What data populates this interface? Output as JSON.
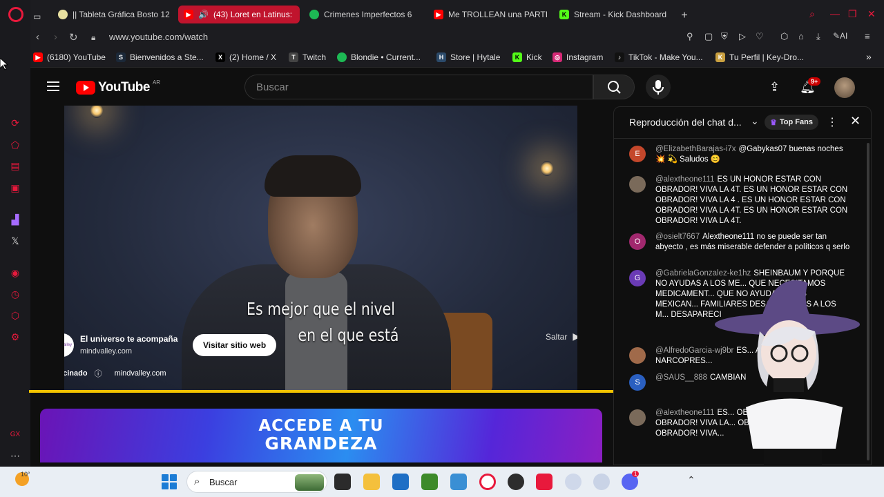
{
  "browser": {
    "tabs": [
      {
        "label": "|| Tableta Gráfica Bosto 12",
        "fav_color": "#e8e0a0",
        "fav_char": ""
      },
      {
        "label": "(43) Loret en Latinus:",
        "fav_color": "#ff0000",
        "fav_char": "▶",
        "active": true
      },
      {
        "label": "Crimenes Imperfectos 6",
        "fav_color": "#1db954",
        "fav_char": ""
      },
      {
        "label": "Me TROLLEAN una PARTII",
        "fav_color": "#ff0000",
        "fav_char": "▶"
      },
      {
        "label": "Stream - Kick Dashboard",
        "fav_color": "#53fc18",
        "fav_char": "K"
      }
    ],
    "url": "www.youtube.com/watch",
    "bookmarks": [
      {
        "label": "(6180) YouTube",
        "color": "#ff0000",
        "char": "▶"
      },
      {
        "label": "Bienvenidos a Ste...",
        "color": "#1b2838",
        "char": "S"
      },
      {
        "label": "(2) Home / X",
        "color": "#000000",
        "char": "X"
      },
      {
        "label": "Twitch",
        "color": "#444444",
        "char": "T"
      },
      {
        "label": "Blondie • Current...",
        "color": "#1db954",
        "char": ""
      },
      {
        "label": "Store | Hytale",
        "color": "#2b4a6a",
        "char": "H"
      },
      {
        "label": "Kick",
        "color": "#53fc18",
        "char": "K"
      },
      {
        "label": "Instagram",
        "color": "#d62976",
        "char": "◎"
      },
      {
        "label": "TikTok - Make You...",
        "color": "#111111",
        "char": "♪"
      },
      {
        "label": "Tu Perfil | Key-Dro...",
        "color": "#c9a040",
        "char": "K"
      }
    ]
  },
  "youtube": {
    "logo_text": "YouTube",
    "region": "AR",
    "search_placeholder": "Buscar",
    "notif_count": "9+"
  },
  "video": {
    "subtitle_line1": "Es mejor que el nivel",
    "subtitle_line2": "en el que está",
    "ad_title": "El universo te acompaña",
    "ad_domain": "mindvalley.com",
    "ad_logo_text": "mindvalley",
    "visit_label": "Visitar sitio web",
    "skip_label": "Saltar",
    "sponsored_label": "Patrocinado",
    "sponsor_domain": "mindvalley.com"
  },
  "banner": {
    "line1": "ACCEDE A TU",
    "line2": "GRANDEZA"
  },
  "chat": {
    "title": "Reproducción del chat d...",
    "top_fans_label": "Top Fans",
    "messages": [
      {
        "initial": "E",
        "avatar_color": "#c4472b",
        "author": "@ElizabethBarajas-i7x",
        "text": "@Gabykas07 buenas noches 💥 💫 Saludos 😊"
      },
      {
        "initial": "",
        "avatar_color": "#7a6a5a",
        "author": "@alextheone111",
        "text": "ES UN HONOR ESTAR CON OBRADOR! VIVA LA 4T. ES UN HONOR ESTAR CON OBRADOR! VIVA LA 4 . ES UN HONOR ESTAR CON OBRADOR! VIVA LA 4T. ES UN HONOR ESTAR CON OBRADOR! VIVA LA 4T."
      },
      {
        "initial": "O",
        "avatar_color": "#a1286e",
        "author": "@osielt7667",
        "text": "Alextheone111 no se puede ser tan abyecto , es más miserable defender a políticos q serlo"
      },
      {
        "initial": "G",
        "avatar_color": "#6a3bb5",
        "author": "@GabrielaGonzalez-ke1hz",
        "text": "SHEINBAUM Y PORQUE NO AYUDAS A LOS ME... QUE NECESITAMOS MEDICAMENT... QUE NO AYUDAS A LOS MEXICAN... FAMILIARES DESA... AYUDAS A LOS M... DESAPARECI"
      },
      {
        "initial": "",
        "avatar_color": "#a06a4a",
        "author": "@AlfredoGarcia-wj9br",
        "text": "ES... AR CON KKDOR NARCOPRES..."
      },
      {
        "initial": "S",
        "avatar_color": "#2a5fc0",
        "author": "@SAUS__888",
        "text": "CAMBIAN"
      },
      {
        "initial": "",
        "avatar_color": "#7a6a5a",
        "author": "@alextheone111",
        "text": "ES... OBRADOR! VIVA LA... OBRADOR! VIVA LA... OBRADOR! VIVA LA... OBRADOR! VIVA..."
      }
    ]
  },
  "taskbar": {
    "temperature": "10°",
    "search_label": "Buscar",
    "discord_badge": "1"
  },
  "colors": {
    "opera_red": "#e8193c",
    "yt_red": "#ff0000",
    "progress_yellow": "#f2c300"
  }
}
